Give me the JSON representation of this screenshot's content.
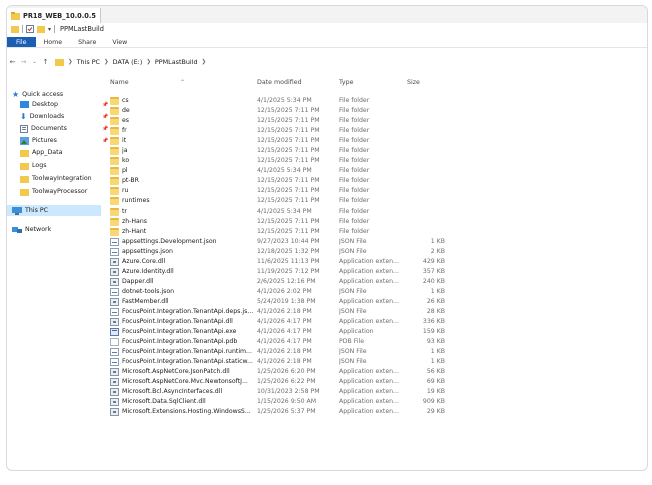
{
  "window": {
    "tab_title": "PR18_WEB_10.0.0.5"
  },
  "qat": {
    "title": "PPMLastBuild"
  },
  "ribbon": {
    "tabs": [
      "File",
      "Home",
      "Share",
      "View"
    ]
  },
  "address": {
    "crumbs": [
      "This PC",
      "DATA (E:)",
      "PPMLastBuild"
    ]
  },
  "nav": {
    "quick_access": "Quick access",
    "items": [
      {
        "label": "Desktop",
        "pinned": true
      },
      {
        "label": "Downloads",
        "pinned": true
      },
      {
        "label": "Documents",
        "pinned": true
      },
      {
        "label": "Pictures",
        "pinned": true
      },
      {
        "label": "App_Data",
        "pinned": false
      },
      {
        "label": "Logs",
        "pinned": false
      },
      {
        "label": "ToolwayIntegration",
        "pinned": false
      },
      {
        "label": "ToolwayProcessor",
        "pinned": false
      }
    ],
    "this_pc": "This PC",
    "network": "Network"
  },
  "columns": {
    "name": "Name",
    "date": "Date modified",
    "type": "Type",
    "size": "Size"
  },
  "files": [
    {
      "name": "cs",
      "date": "4/1/2025 5:34 PM",
      "type": "File folder",
      "size": "",
      "icon": "folder"
    },
    {
      "name": "de",
      "date": "12/15/2025 7:11 PM",
      "type": "File folder",
      "size": "",
      "icon": "folder"
    },
    {
      "name": "es",
      "date": "12/15/2025 7:11 PM",
      "type": "File folder",
      "size": "",
      "icon": "folder"
    },
    {
      "name": "fr",
      "date": "12/15/2025 7:11 PM",
      "type": "File folder",
      "size": "",
      "icon": "folder"
    },
    {
      "name": "it",
      "date": "12/15/2025 7:11 PM",
      "type": "File folder",
      "size": "",
      "icon": "folder"
    },
    {
      "name": "ja",
      "date": "12/15/2025 7:11 PM",
      "type": "File folder",
      "size": "",
      "icon": "folder"
    },
    {
      "name": "ko",
      "date": "12/15/2025 7:11 PM",
      "type": "File folder",
      "size": "",
      "icon": "folder"
    },
    {
      "name": "pl",
      "date": "4/1/2025 5:34 PM",
      "type": "File folder",
      "size": "",
      "icon": "folder"
    },
    {
      "name": "pt-BR",
      "date": "12/15/2025 7:11 PM",
      "type": "File folder",
      "size": "",
      "icon": "folder"
    },
    {
      "name": "ru",
      "date": "12/15/2025 7:11 PM",
      "type": "File folder",
      "size": "",
      "icon": "folder"
    },
    {
      "name": "runtimes",
      "date": "12/15/2025 7:11 PM",
      "type": "File folder",
      "size": "",
      "icon": "folder"
    },
    {
      "name": "tr",
      "date": "4/1/2025 5:34 PM",
      "type": "File folder",
      "size": "",
      "icon": "folder"
    },
    {
      "name": "zh-Hans",
      "date": "12/15/2025 7:11 PM",
      "type": "File folder",
      "size": "",
      "icon": "folder"
    },
    {
      "name": "zh-Hant",
      "date": "12/15/2025 7:11 PM",
      "type": "File folder",
      "size": "",
      "icon": "folder"
    },
    {
      "name": "appsettings.Development.json",
      "date": "9/27/2023 10:44 PM",
      "type": "JSON File",
      "size": "1 KB",
      "icon": "json"
    },
    {
      "name": "appsettings.json",
      "date": "12/18/2025 1:32 PM",
      "type": "JSON File",
      "size": "2 KB",
      "icon": "json"
    },
    {
      "name": "Azure.Core.dll",
      "date": "11/6/2025 11:13 PM",
      "type": "Application exten...",
      "size": "429 KB",
      "icon": "dll"
    },
    {
      "name": "Azure.Identity.dll",
      "date": "11/19/2025 7:12 PM",
      "type": "Application exten...",
      "size": "357 KB",
      "icon": "dll"
    },
    {
      "name": "Dapper.dll",
      "date": "2/6/2025 12:16 PM",
      "type": "Application exten...",
      "size": "240 KB",
      "icon": "dll"
    },
    {
      "name": "dotnet-tools.json",
      "date": "4/1/2026 2:02 PM",
      "type": "JSON File",
      "size": "1 KB",
      "icon": "json"
    },
    {
      "name": "FastMember.dll",
      "date": "5/24/2019 1:38 PM",
      "type": "Application exten...",
      "size": "26 KB",
      "icon": "dll"
    },
    {
      "name": "FocusPoint.Integration.TenantApi.deps.js...",
      "date": "4/1/2026 2:18 PM",
      "type": "JSON File",
      "size": "28 KB",
      "icon": "json"
    },
    {
      "name": "FocusPoint.Integration.TenantApi.dll",
      "date": "4/1/2026 4:17 PM",
      "type": "Application exten...",
      "size": "336 KB",
      "icon": "dll"
    },
    {
      "name": "FocusPoint.Integration.TenantApi.exe",
      "date": "4/1/2026 4:17 PM",
      "type": "Application",
      "size": "159 KB",
      "icon": "exe"
    },
    {
      "name": "FocusPoint.Integration.TenantApi.pdb",
      "date": "4/1/2026 4:17 PM",
      "type": "PDB File",
      "size": "93 KB",
      "icon": "pdb"
    },
    {
      "name": "FocusPoint.Integration.TenantApi.runtim...",
      "date": "4/1/2026 2:18 PM",
      "type": "JSON File",
      "size": "1 KB",
      "icon": "json"
    },
    {
      "name": "FocusPoint.Integration.TenantApi.staticw...",
      "date": "4/1/2026 2:18 PM",
      "type": "JSON File",
      "size": "1 KB",
      "icon": "json"
    },
    {
      "name": "Microsoft.AspNetCore.JsonPatch.dll",
      "date": "1/25/2026 6:20 PM",
      "type": "Application exten...",
      "size": "56 KB",
      "icon": "dll"
    },
    {
      "name": "Microsoft.AspNetCore.Mvc.NewtonsoftJ...",
      "date": "1/25/2026 6:22 PM",
      "type": "Application exten...",
      "size": "69 KB",
      "icon": "dll"
    },
    {
      "name": "Microsoft.Bcl.AsyncInterfaces.dll",
      "date": "10/31/2023 2:58 PM",
      "type": "Application exten...",
      "size": "19 KB",
      "icon": "dll"
    },
    {
      "name": "Microsoft.Data.SqlClient.dll",
      "date": "1/15/2026 9:50 AM",
      "type": "Application exten...",
      "size": "909 KB",
      "icon": "dll"
    },
    {
      "name": "Microsoft.Extensions.Hosting.WindowsS...",
      "date": "1/25/2026 5:37 PM",
      "type": "Application exten...",
      "size": "29 KB",
      "icon": "dll"
    }
  ]
}
